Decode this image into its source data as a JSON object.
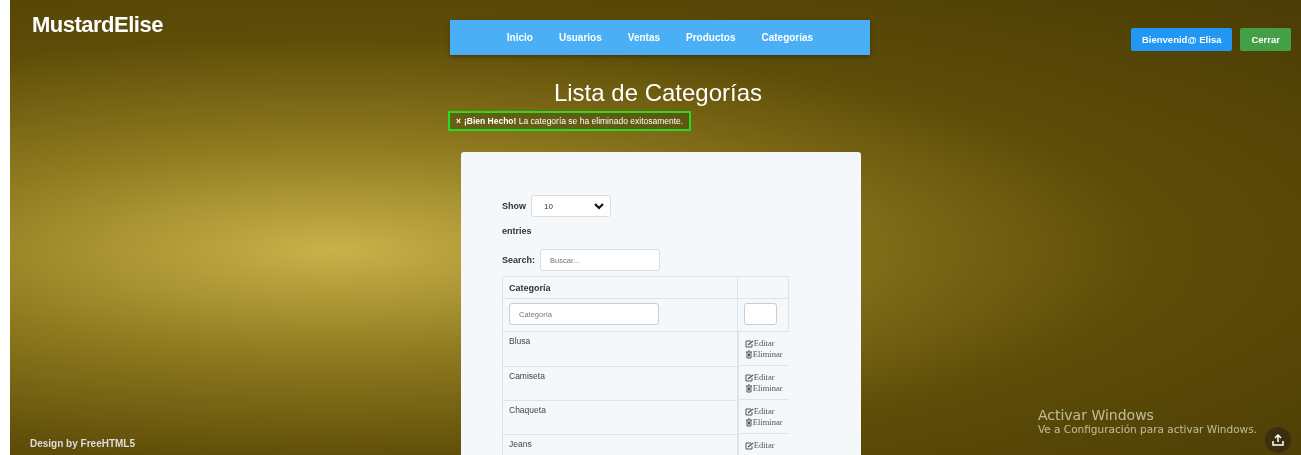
{
  "brand": "MustardElise",
  "nav": [
    {
      "label": "Inicio"
    },
    {
      "label": "Usuarios"
    },
    {
      "label": "Ventas"
    },
    {
      "label": "Productos"
    },
    {
      "label": "Categorías"
    }
  ],
  "user_buttons": [
    {
      "label": "Bienvenid@ Elisa",
      "kind": "primary"
    },
    {
      "label": "Cerrar",
      "kind": "success"
    }
  ],
  "title": "Lista de Categorías",
  "alert": {
    "close": "×",
    "text": "**¡Bien Hecho!** La categoría se ha eliminado exitosamente."
  },
  "table_controls": {
    "show_label": "Show",
    "page_size": "10",
    "entries_label": "entries",
    "search_label": "Search:",
    "search_placeholder": "Buscar..."
  },
  "table": {
    "columns": [
      "Categoría"
    ],
    "filter_placeholder": "Categoría",
    "rows": [
      {
        "name": "Blusa",
        "actions": [
          {
            "label": "Editar",
            "kind": "edit"
          },
          {
            "label": "Eliminar",
            "kind": "delete"
          }
        ]
      },
      {
        "name": "Camiseta",
        "actions": [
          {
            "label": "Editar",
            "kind": "edit"
          },
          {
            "label": "Eliminar",
            "kind": "delete"
          }
        ]
      },
      {
        "name": "Chaqueta",
        "actions": [
          {
            "label": "Editar",
            "kind": "edit"
          },
          {
            "label": "Eliminar",
            "kind": "delete"
          }
        ]
      },
      {
        "name": "Jeans",
        "actions": [
          {
            "label": "Editar",
            "kind": "edit"
          }
        ]
      }
    ]
  },
  "footer": "Design by FreeHTML5",
  "os_notice": {
    "title": "Activar Windows",
    "text": "Ve a Configuración para activar Windows."
  }
}
